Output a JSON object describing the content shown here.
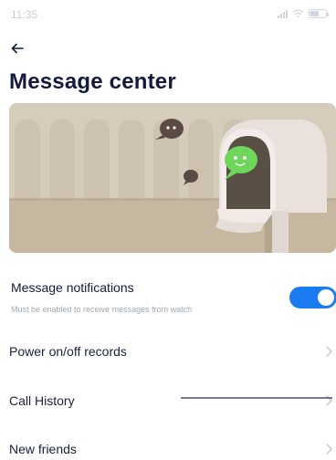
{
  "status_bar": {
    "time": "11:35",
    "battery_level": "56"
  },
  "header": {
    "title": "Message center"
  },
  "notifications": {
    "title": "Message notifications",
    "subtitle": "Must be enabled to receive messages from watch",
    "enabled": true
  },
  "list": {
    "items": [
      {
        "label": "Power on/off records"
      },
      {
        "label": "Call History"
      },
      {
        "label": "New friends"
      }
    ]
  },
  "colors": {
    "title": "#131a3d",
    "accent": "#1a7cf0",
    "banner_bg": "#d6ccbb",
    "mailbox": "#ede4e1",
    "bubble_green": "#6fd65c",
    "bubble_dark": "#5a4a44"
  },
  "icons": {
    "back": "arrow-left-icon",
    "chevron": "chevron-right-icon"
  }
}
